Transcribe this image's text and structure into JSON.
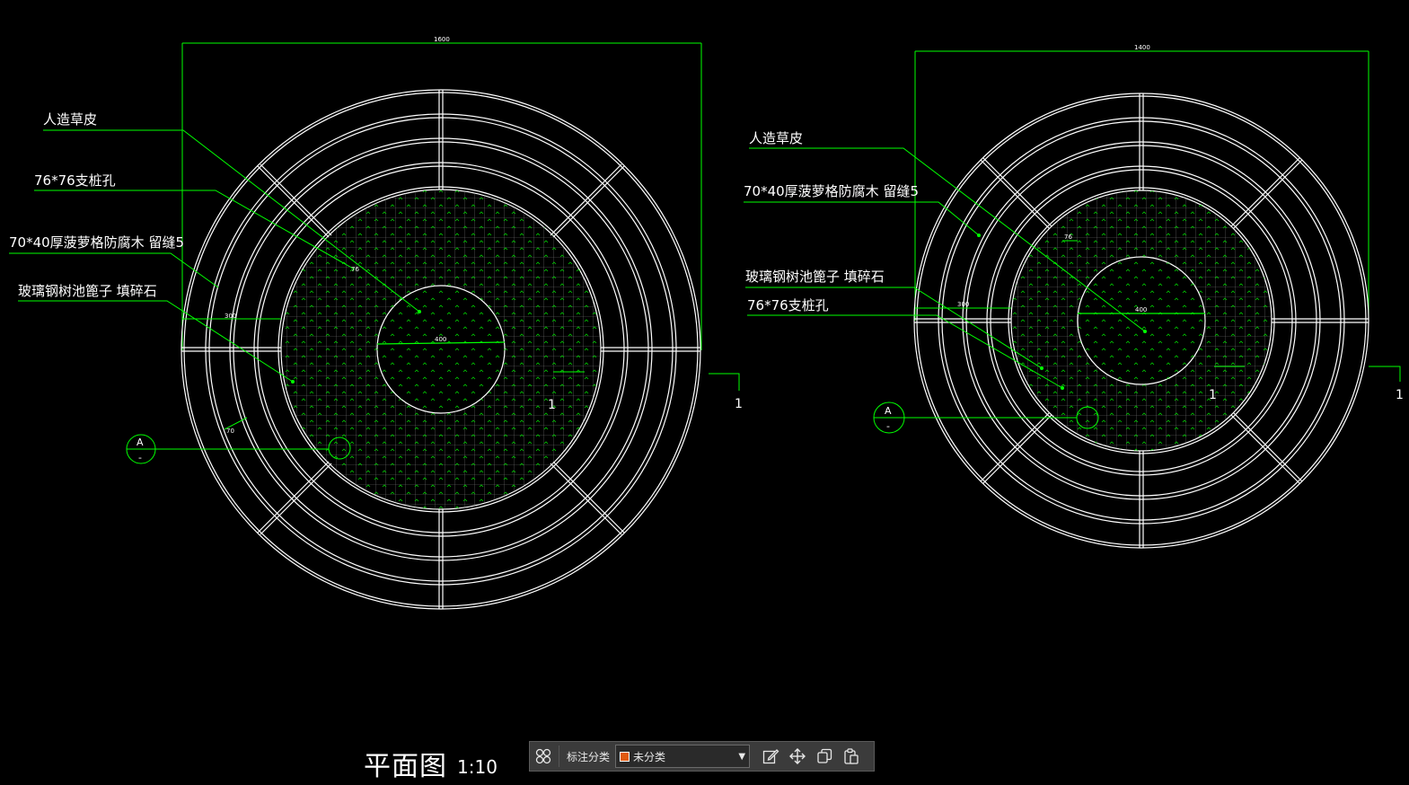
{
  "drawing": {
    "left_plan": {
      "overall_dim": "1600",
      "labels": [
        "人造草皮",
        "76*76支桩孔",
        "70*40厚菠萝格防腐木 留缝5",
        "玻璃钢树池篦子 填碎石"
      ],
      "dim_inner": "400",
      "dim_76": "76",
      "dim_300": "300",
      "dim_70": "70",
      "section_letter": "A",
      "section_sub": "-",
      "section_number": "1",
      "section_number_inner": "1"
    },
    "right_plan": {
      "overall_dim": "1400",
      "labels": [
        "人造草皮",
        "70*40厚菠萝格防腐木 留缝5",
        "玻璃钢树池篦子 填碎石",
        "76*76支桩孔"
      ],
      "dim_inner": "400",
      "dim_76": "76",
      "dim_300": "300",
      "section_letter": "A",
      "section_sub": "-",
      "section_number": "1",
      "section_number_inner": "1"
    },
    "title": "平面图",
    "scale": "1:10",
    "colors": {
      "line": "#ffffff",
      "leader": "#00ff00",
      "hatch": "#00c800",
      "background": "#000000"
    }
  },
  "toolbar": {
    "grid_icon": "grid-icon",
    "category_label": "标注分类",
    "select_value": "未分类",
    "select_swatch": "#e05a10",
    "edit_icon": "edit-icon",
    "move_icon": "move-icon",
    "copy_icon": "copy-icon",
    "paste_icon": "paste-icon"
  }
}
